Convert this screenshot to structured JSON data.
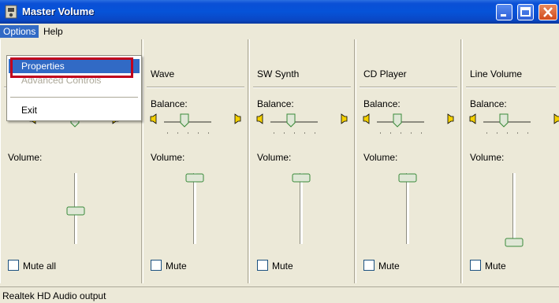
{
  "window": {
    "title": "Master Volume"
  },
  "menubar": {
    "items": [
      {
        "label": "Options"
      },
      {
        "label": "Help"
      }
    ]
  },
  "dropdown": {
    "items": [
      {
        "label": "Properties",
        "state": "selected"
      },
      {
        "label": "Advanced Controls",
        "state": "disabled"
      },
      {
        "label": "Exit",
        "state": "normal"
      }
    ]
  },
  "columns": [
    {
      "title": "",
      "balance_label": "",
      "volume_label": "Volume:",
      "mute_label": "Mute all",
      "volume_level": 0.32
    },
    {
      "title": "Wave",
      "balance_label": "Balance:",
      "volume_label": "Volume:",
      "mute_label": "Mute",
      "volume_level": 0.97
    },
    {
      "title": "SW Synth",
      "balance_label": "Balance:",
      "volume_label": "Volume:",
      "mute_label": "Mute",
      "volume_level": 0.97
    },
    {
      "title": "CD Player",
      "balance_label": "Balance:",
      "volume_label": "Volume:",
      "mute_label": "Mute",
      "volume_level": 0.97
    },
    {
      "title": "Line Volume",
      "balance_label": "Balance:",
      "volume_label": "Volume:",
      "mute_label": "Mute",
      "volume_level": 0.05
    }
  ],
  "statusbar": {
    "text": "Realtek HD Audio output"
  },
  "colors": {
    "title_blue": "#0653d8",
    "highlight_red": "#c0001c",
    "selection_blue": "#316ac5",
    "panel_bg": "#ece9d8"
  }
}
